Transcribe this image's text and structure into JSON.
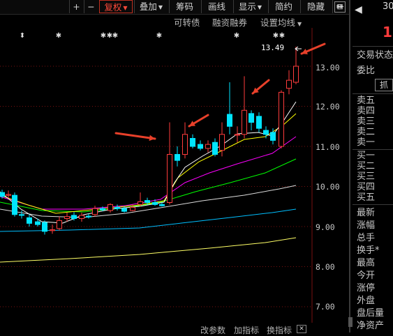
{
  "toolbar": {
    "plus": "+",
    "minus": "−",
    "fuquan": "复权",
    "diejia": "叠加",
    "chouma": "筹码",
    "huaxian": "画线",
    "xianshi": "显示",
    "jianyue": "简约",
    "yincang": "隐藏",
    "more": "▸▸",
    "collapse": "⊠"
  },
  "subbar": {
    "kezhuanzhai": "可转债",
    "rongzi": "融资融券",
    "junxian": "设置均线"
  },
  "chart": {
    "price_label": "13.49",
    "axis_ticks": [
      "13.00",
      "12.00",
      "11.00",
      "10.00",
      "9.00",
      "8.00",
      "7.00"
    ],
    "colors": {
      "up": "#ff3c3c",
      "down": "#00e5ff",
      "ma5": "#ffffff",
      "ma10": "#ffff00",
      "ma20": "#ff00ff",
      "ma30": "#00ff00",
      "ma60": "#ffffff",
      "ma120": "#00bfff",
      "ma250": "#ffff66",
      "arrow": "#e8402a"
    }
  },
  "right_panel": {
    "code": "30",
    "price": "1",
    "labels": [
      "交易状态",
      "委比"
    ],
    "button": "抓",
    "sell": [
      "卖五",
      "卖四",
      "卖三",
      "卖二",
      "卖一"
    ],
    "buy": [
      "买一",
      "买二",
      "买三",
      "买四",
      "买五"
    ],
    "stats": [
      "最新",
      "涨幅",
      "总手",
      "换手*",
      "最高",
      "今开",
      "涨停",
      "外盘",
      "盘后量",
      "净资产"
    ]
  },
  "bottom": {
    "gaicanshu": "改参数",
    "jiazhibiao": "加指标",
    "huanzhibiao": "换指标",
    "close": "✕"
  }
}
